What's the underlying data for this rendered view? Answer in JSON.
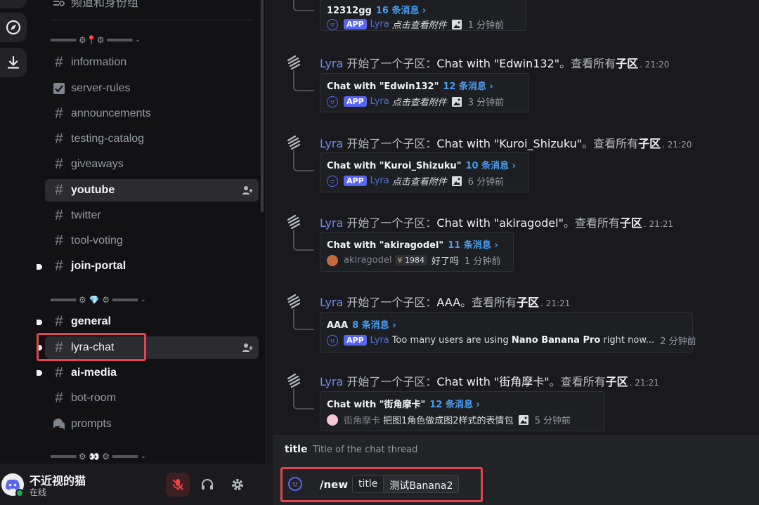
{
  "sidebar": {
    "partial_top_channel": "频道和身份组",
    "categories": [
      {
        "label": "═════ ⚙📍⚙ ═════",
        "chevron": "⌄"
      },
      {
        "label": "═════ ⚙ 💎 ⚙ ═════",
        "chevron": "⌄"
      },
      {
        "label": "═════ ⚙ 👀 ⚙ ═════",
        "chevron": "⌄"
      }
    ],
    "channels": [
      {
        "name": "information",
        "icon": "hash-icon"
      },
      {
        "name": "server-rules",
        "icon": "rules-icon"
      },
      {
        "name": "announcements",
        "icon": "hash-icon"
      },
      {
        "name": "testing-catalog",
        "icon": "hash-icon"
      },
      {
        "name": "giveaways",
        "icon": "hash-icon"
      },
      {
        "name": "youtube",
        "icon": "hash-icon",
        "active": true
      },
      {
        "name": "twitter",
        "icon": "hash-icon"
      },
      {
        "name": "tool-voting",
        "icon": "hash-icon"
      },
      {
        "name": "join-portal",
        "icon": "hash-icon",
        "unread": true
      },
      {
        "name": "general",
        "icon": "hash-icon",
        "unread": true
      },
      {
        "name": "lyra-chat",
        "icon": "hash-icon",
        "selected": true
      },
      {
        "name": "ai-media",
        "icon": "hash-icon",
        "unread": true
      },
      {
        "name": "bot-room",
        "icon": "hash-icon"
      },
      {
        "name": "prompts",
        "icon": "forum-icon"
      }
    ]
  },
  "user": {
    "name": "不近视的猫",
    "status": "在线"
  },
  "messages": {
    "partial_card": {
      "title": "12312gg",
      "count": "16 条消息 ›",
      "badge": "APP",
      "author": "Lyra",
      "text": "点击查看附件",
      "ago": "1 分钟前"
    },
    "items": [
      {
        "author": "Lyra",
        "prefix": "开始了一个子区：",
        "thread": "Chat with \"Edwin132\"",
        "suffix": "。查看所有",
        "link": "子区",
        "time": ". 21:20",
        "card": {
          "title": "Chat with \"Edwin132\"",
          "count": "12 条消息 ›",
          "badge": "APP",
          "author": "Lyra",
          "text": "点击查看附件",
          "ago": "3 分钟前"
        }
      },
      {
        "author": "Lyra",
        "prefix": "开始了一个子区：",
        "thread": "Chat with \"Kuroi_Shizuku\"",
        "suffix": "。查看所有",
        "link": "子区",
        "time": ". 21:20",
        "card": {
          "title": "Chat with \"Kuroi_Shizuku\"",
          "count": "10 条消息 ›",
          "badge": "APP",
          "author": "Lyra",
          "text": "点击查看附件",
          "ago": "6 分钟前"
        }
      },
      {
        "author": "Lyra",
        "prefix": "开始了一个子区：",
        "thread": "Chat with \"akiragodel\"",
        "suffix": "。查看所有",
        "link": "子区",
        "time": ". 21:21",
        "card": {
          "title": "Chat with \"akiragodel\"",
          "count": "11 条消息 ›",
          "author": "akiragodel",
          "level": "1984",
          "text": "好了吗",
          "ago": "1 分钟前"
        }
      },
      {
        "author": "Lyra",
        "prefix": "开始了一个子区：",
        "thread": "AAA",
        "suffix": "。查看所有",
        "link": "子区",
        "time": ". 21:21",
        "card": {
          "title": "AAA",
          "count": "8 条消息 ›",
          "badge": "APP",
          "author": "Lyra",
          "text_pre": "Too many users are using ",
          "text_bold": "Nano Banana Pro",
          "text_post": " right now...",
          "ago": "2 分钟前"
        }
      },
      {
        "author": "Lyra",
        "prefix": "开始了一个子区：",
        "thread": "Chat with \"街角摩卡\"",
        "suffix": "。查看所有",
        "link": "子区",
        "time": ". 21:21",
        "card": {
          "title": "Chat with \"街角摩卡\"",
          "count": "12 条消息 ›",
          "author": "街角摩卡",
          "text": "把图1角色做成图2样式的表情包",
          "ago": "5 分钟前"
        }
      }
    ]
  },
  "option_hint": {
    "name": "title",
    "description": "Title of the chat thread"
  },
  "composer": {
    "command": "/new",
    "param_key": "title",
    "param_value": "测试Banana2"
  },
  "colors": {
    "highlight": "#e0474c",
    "accent": "#5865f2",
    "link": "#4a9cf0"
  }
}
